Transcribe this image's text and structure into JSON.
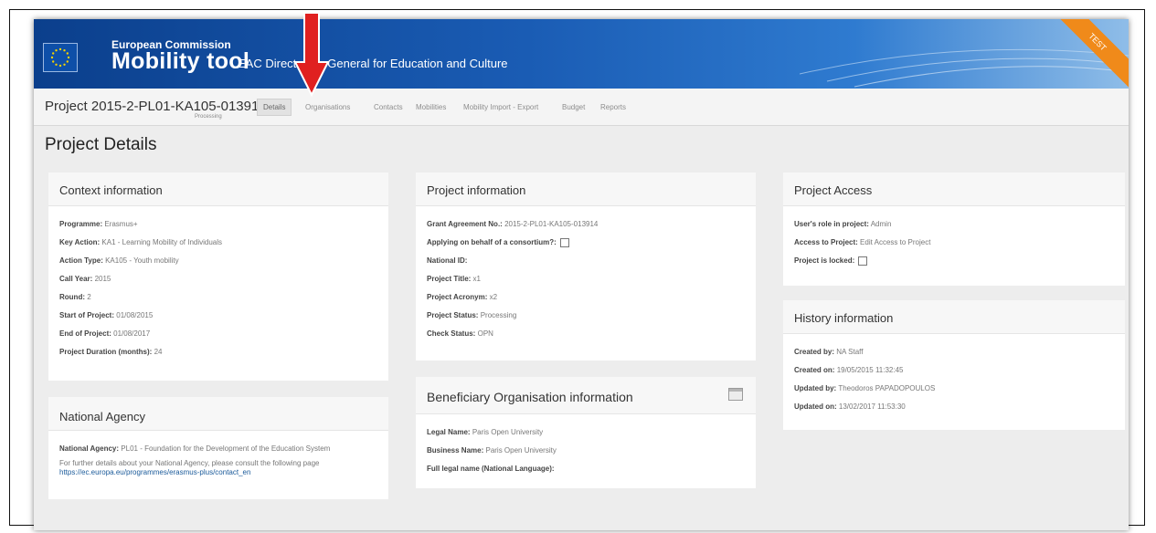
{
  "header": {
    "ec_label": "European Commission",
    "app_title": "Mobility tool",
    "dg_title": "EAC Directorate-General for Education and Culture",
    "ribbon": "TEST"
  },
  "nav": {
    "project_code": "Project 2015-2-PL01-KA105-013914",
    "project_sub": "Processing",
    "tabs": [
      "Details",
      "Organisations",
      "Contacts",
      "Mobilities",
      "Mobility Import - Export",
      "Budget",
      "Reports"
    ],
    "active_tab": "Details"
  },
  "page_title": "Project Details",
  "context": {
    "title": "Context information",
    "rows": [
      {
        "label": "Programme:",
        "value": "Erasmus+"
      },
      {
        "label": "Key Action:",
        "value": "KA1 - Learning Mobility of Individuals"
      },
      {
        "label": "Action Type:",
        "value": "KA105 - Youth mobility"
      },
      {
        "label": "Call Year:",
        "value": "2015"
      },
      {
        "label": "Round:",
        "value": "2"
      },
      {
        "label": "Start of Project:",
        "value": "01/08/2015"
      },
      {
        "label": "End of Project:",
        "value": "01/08/2017"
      },
      {
        "label": "Project Duration (months):",
        "value": "24"
      }
    ]
  },
  "national_agency": {
    "title": "National Agency",
    "label": "National Agency:",
    "value": "PL01 - Foundation for the Development of the Education System",
    "note": "For further details about your National Agency, please consult the following page",
    "link": "https://ec.europa.eu/programmes/erasmus-plus/contact_en"
  },
  "project_info": {
    "title": "Project information",
    "rows": [
      {
        "label": "Grant Agreement No.:",
        "value": "2015-2-PL01-KA105-013914"
      },
      {
        "label": "Applying on behalf of a consortium?:",
        "value": ""
      },
      {
        "label": "National ID:",
        "value": ""
      },
      {
        "label": "Project Title:",
        "value": "x1"
      },
      {
        "label": "Project Acronym:",
        "value": "x2"
      },
      {
        "label": "Project Status:",
        "value": "Processing"
      },
      {
        "label": "Check Status:",
        "value": "OPN"
      }
    ]
  },
  "beneficiary": {
    "title": "Beneficiary Organisation information",
    "rows": [
      {
        "label": "Legal Name:",
        "value": "Paris Open University"
      },
      {
        "label": "Business Name:",
        "value": "Paris Open University"
      },
      {
        "label": "Full legal name (National Language):",
        "value": ""
      }
    ]
  },
  "access": {
    "title": "Project Access",
    "rows": [
      {
        "label": "User's role in project:",
        "value": "Admin"
      },
      {
        "label": "Access to Project:",
        "value": "Edit Access to Project"
      },
      {
        "label": "Project is locked:",
        "value": ""
      }
    ]
  },
  "history": {
    "title": "History information",
    "rows": [
      {
        "label": "Created by:",
        "value": "NA Staff"
      },
      {
        "label": "Created on:",
        "value": "19/05/2015 11:32:45"
      },
      {
        "label": "Updated by:",
        "value": "Theodoros PAPADOPOULOS"
      },
      {
        "label": "Updated on:",
        "value": "13/02/2017 11:53:30"
      }
    ]
  },
  "colors": {
    "header_blue": "#1a5cb4",
    "arrow_red": "#e02020",
    "ribbon_orange": "#f08a1a",
    "link_blue": "#1a5a9a"
  }
}
